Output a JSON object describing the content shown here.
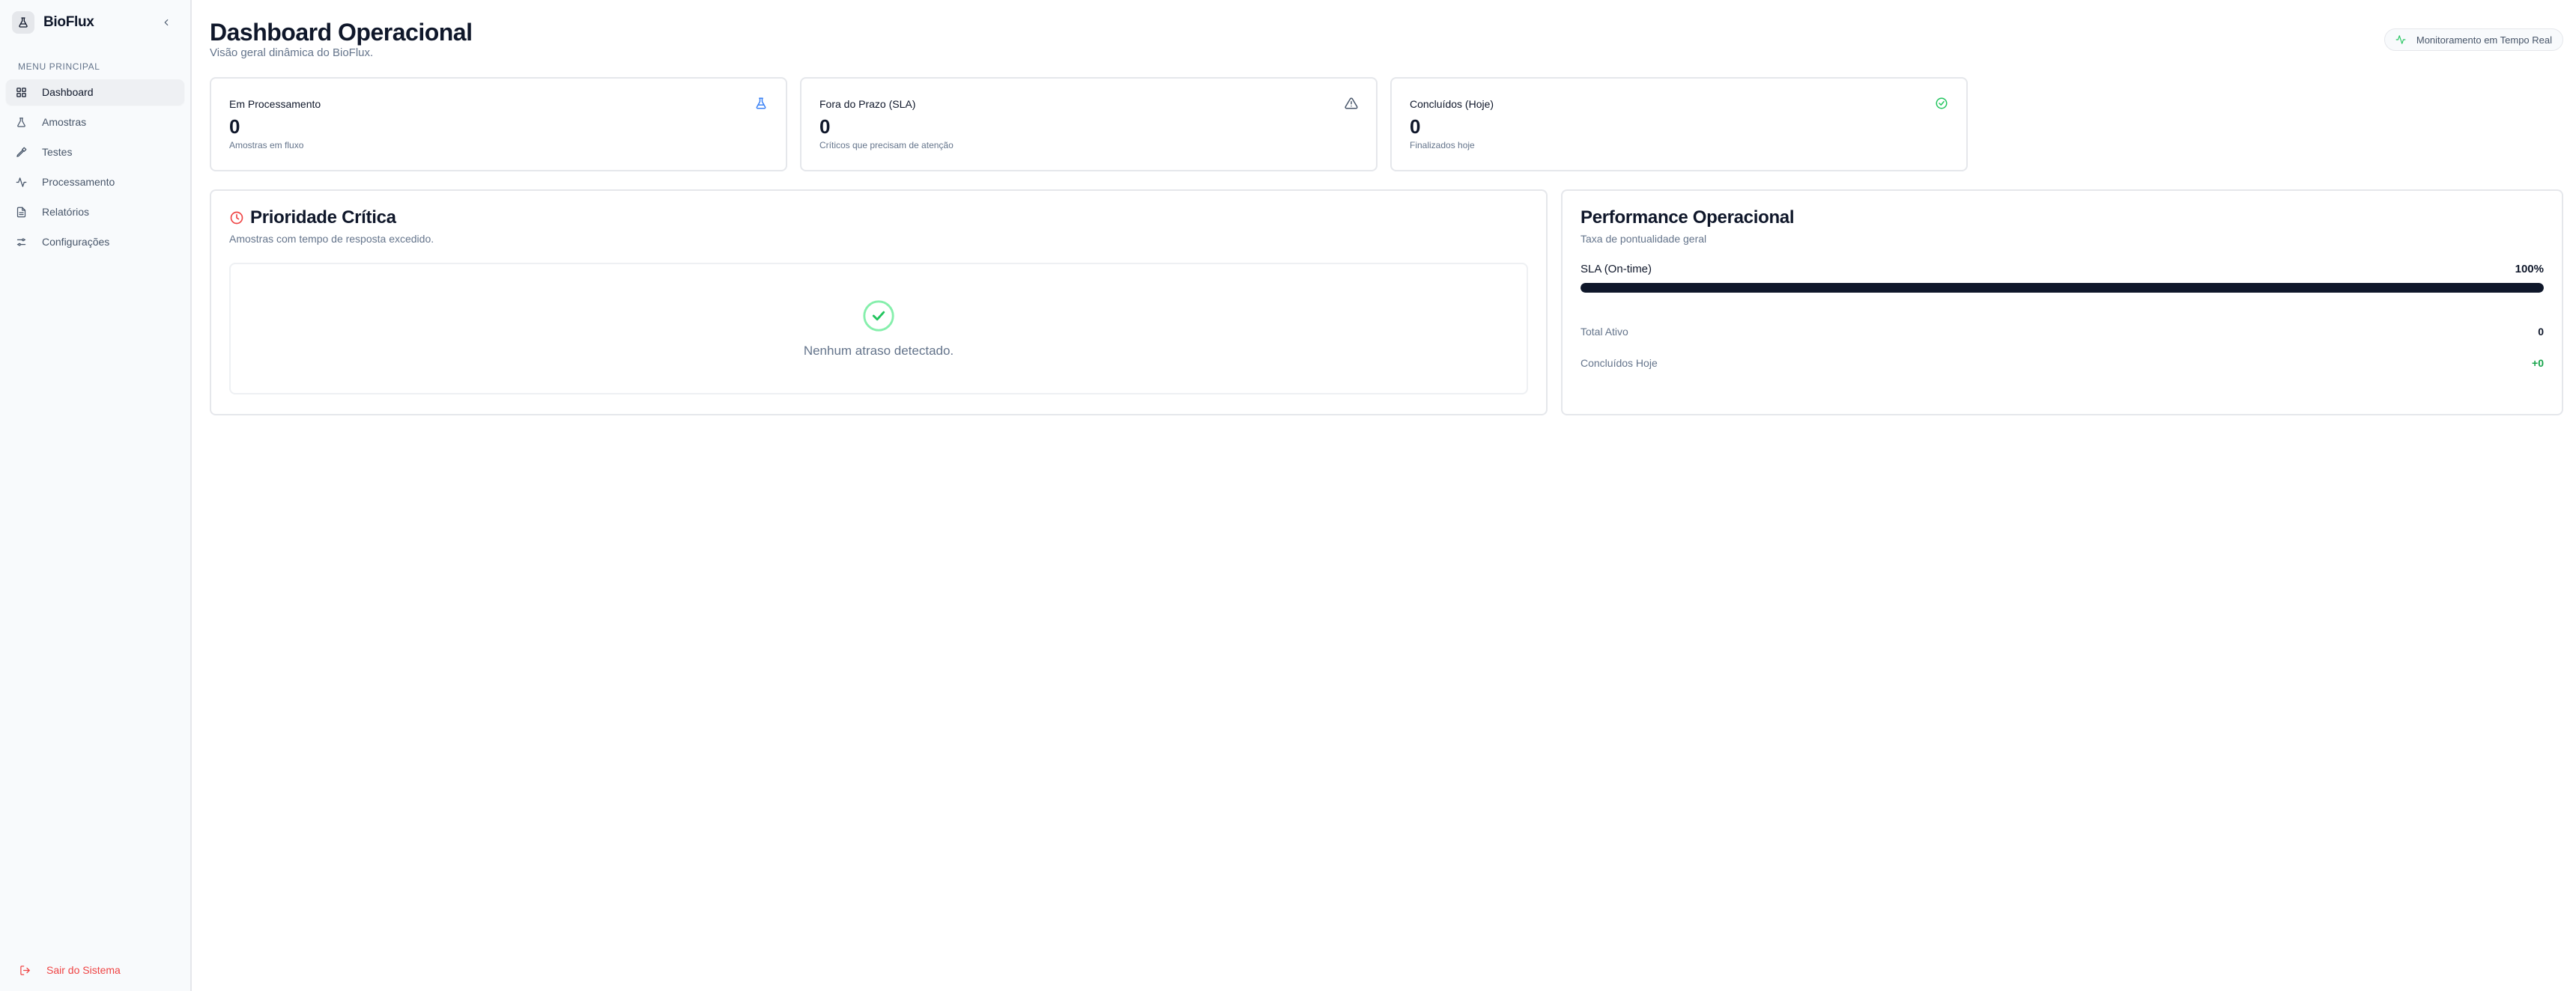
{
  "brand": {
    "name": "BioFlux"
  },
  "sidebar": {
    "menu_label": "MENU PRINCIPAL",
    "items": [
      {
        "label": "Dashboard",
        "icon": "dashboard-icon",
        "active": true
      },
      {
        "label": "Amostras",
        "icon": "flask-icon",
        "active": false
      },
      {
        "label": "Testes",
        "icon": "pipette-icon",
        "active": false
      },
      {
        "label": "Processamento",
        "icon": "activity-icon",
        "active": false
      },
      {
        "label": "Relatórios",
        "icon": "report-icon",
        "active": false
      },
      {
        "label": "Configurações",
        "icon": "sliders-icon",
        "active": false
      }
    ],
    "logout_label": "Sair do Sistema"
  },
  "header": {
    "title": "Dashboard Operacional",
    "subtitle": "Visão geral dinâmica do BioFlux.",
    "live_badge": "Monitoramento em Tempo Real"
  },
  "stats": [
    {
      "title": "Em Processamento",
      "value": "0",
      "desc": "Amostras em fluxo",
      "icon": "flask-icon",
      "icon_color": "#3b82f6"
    },
    {
      "title": "Fora do Prazo (SLA)",
      "value": "0",
      "desc": "Críticos que precisam de atenção",
      "icon": "warning-icon",
      "icon_color": "#475569"
    },
    {
      "title": "Concluídos (Hoje)",
      "value": "0",
      "desc": "Finalizados hoje",
      "icon": "check-circle-icon",
      "icon_color": "#22c55e"
    }
  ],
  "critical": {
    "title": "Prioridade Crítica",
    "subtitle": "Amostras com tempo de resposta excedido.",
    "empty_text": "Nenhum atraso detectado.",
    "accent": "#ef4444"
  },
  "performance": {
    "title": "Performance Operacional",
    "subtitle": "Taxa de pontualidade geral",
    "sla_label": "SLA (On-time)",
    "sla_value": "100%",
    "sla_percent": 100,
    "total_label": "Total Ativo",
    "total_value": "0",
    "done_label": "Concluídos Hoje",
    "done_value": "+0"
  },
  "colors": {
    "primary": "#0f172a",
    "muted": "#64748b",
    "danger": "#ef4444",
    "success": "#22c55e"
  }
}
